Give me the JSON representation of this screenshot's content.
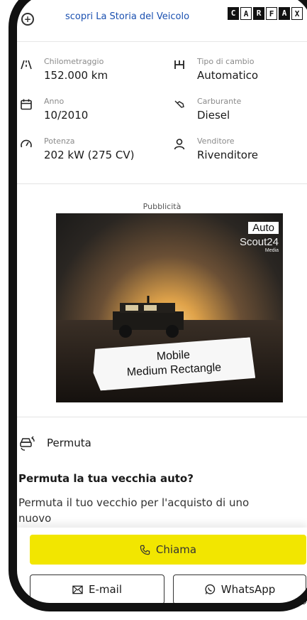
{
  "carfax": {
    "link_text": "scopri La Storia del Veicolo",
    "logo_letters": [
      "C",
      "A",
      "R",
      "F",
      "A",
      "X"
    ]
  },
  "specs": [
    {
      "label": "Chilometraggio",
      "value": "152.000 km",
      "icon": "odometer-road-icon"
    },
    {
      "label": "Tipo di cambio",
      "value": "Automatico",
      "icon": "gearbox-icon"
    },
    {
      "label": "Anno",
      "value": "10/2010",
      "icon": "calendar-icon"
    },
    {
      "label": "Carburante",
      "value": "Diesel",
      "icon": "fuel-pump-icon"
    },
    {
      "label": "Potenza",
      "value": "202 kW (275 CV)",
      "icon": "speedometer-icon"
    },
    {
      "label": "Venditore",
      "value": "Rivenditore",
      "icon": "person-icon"
    }
  ],
  "ad": {
    "label": "Pubblicità",
    "logo_top": "Auto",
    "logo_bottom": "Scout24",
    "logo_media": "Media",
    "banner_line1": "Mobile",
    "banner_line2": "Medium Rectangle"
  },
  "permuta": {
    "title": "Permuta",
    "heading": "Permuta la tua vecchia auto?",
    "text": "Permuta il tuo vecchio per l'acquisto di uno nuovo"
  },
  "actions": {
    "call_label": "Chiama",
    "email_label": "E-mail",
    "whatsapp_label": "WhatsApp"
  },
  "colors": {
    "call_button": "#f2e600",
    "link": "#1a50b0"
  }
}
